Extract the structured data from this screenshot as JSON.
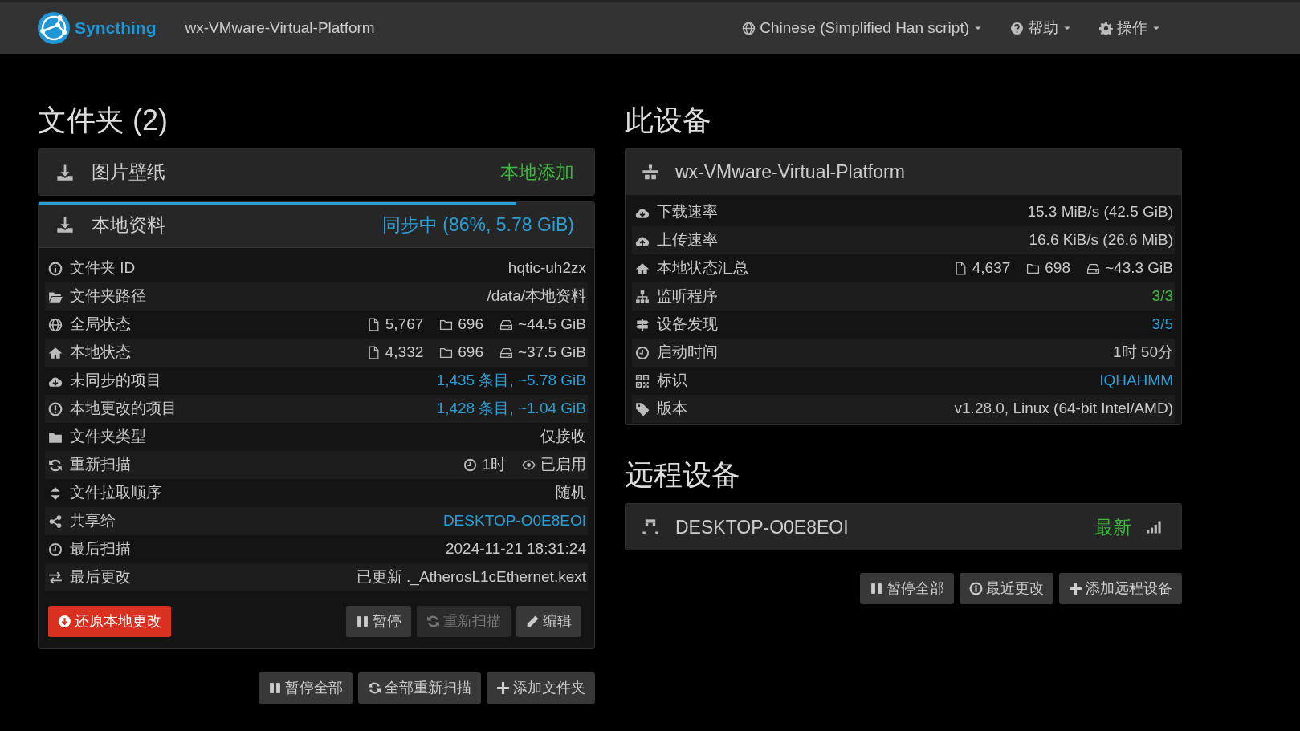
{
  "navbar": {
    "brand": "Syncthing",
    "device_name": "wx-VMware-Virtual-Platform",
    "menus": [
      "Chinese (Simplified Han script)",
      "帮助",
      "操作"
    ]
  },
  "folders": {
    "heading": "文件夹 (2)",
    "items": [
      {
        "name": "图片壁纸",
        "status": "本地添加",
        "color": "#3fb83f",
        "expanded": false
      },
      {
        "name": "本地资料",
        "status": "同步中 (86%, 5.78 GiB)",
        "color": "#2a9fd6",
        "level": 0.86,
        "expanded": true,
        "details": [
          {
            "kind": "text",
            "label": "文件夹 ID",
            "value": "hqtic-uh2zx"
          },
          {
            "kind": "text",
            "label": "文件夹路径",
            "value": "/data/本地资料"
          },
          {
            "kind": "stats",
            "label": "全局状态",
            "files": "5,767",
            "dirs": "696",
            "size": "~44.5 GiB"
          },
          {
            "kind": "stats",
            "label": "本地状态",
            "files": "4,332",
            "dirs": "696",
            "size": "~37.5 GiB"
          },
          {
            "kind": "text",
            "label": "未同步的项目",
            "value": "1,435 条目, ~5.78 GiB",
            "color": "#2a9fd6"
          },
          {
            "kind": "text",
            "label": "本地更改的项目",
            "value": "1,428 条目, ~1.04 GiB",
            "color": "#2a9fd6"
          },
          {
            "kind": "text",
            "label": "文件夹类型",
            "value": "仅接收"
          },
          {
            "kind": "rescan",
            "label": "重新扫描",
            "interval": "1时",
            "watch": "已启用"
          },
          {
            "kind": "text",
            "label": "文件拉取顺序",
            "value": "随机"
          },
          {
            "kind": "text",
            "label": "共享给",
            "value": "DESKTOP-O0E8EOI",
            "color": "#2a9fd6"
          },
          {
            "kind": "text",
            "label": "最后扫描",
            "value": "2024-11-21 18:31:24"
          },
          {
            "kind": "text",
            "label": "最后更改",
            "value": "已更新 ._AtherosL1cEthernet.kext"
          }
        ],
        "actions": [
          {
            "label": "还原本地更改",
            "kind": "danger",
            "disabled": false
          },
          {
            "label": "暂停",
            "kind": "default",
            "disabled": false
          },
          {
            "label": "重新扫描",
            "kind": "default",
            "disabled": true
          },
          {
            "label": "编辑",
            "kind": "default",
            "disabled": false
          }
        ]
      }
    ],
    "buttons": [
      "暂停全部",
      "全部重新扫描",
      "添加文件夹"
    ]
  },
  "this_device": {
    "heading": "此设备",
    "name": "wx-VMware-Virtual-Platform",
    "details": [
      {
        "kind": "text",
        "label": "下载速率",
        "value": "15.3 MiB/s (42.5 GiB)"
      },
      {
        "kind": "text",
        "label": "上传速率",
        "value": "16.6 KiB/s (26.6 MiB)"
      },
      {
        "kind": "stats",
        "label": "本地状态汇总",
        "files": "4,637",
        "dirs": "698",
        "size": "~43.3 GiB"
      },
      {
        "kind": "text",
        "label": "监听程序",
        "value": "3/3",
        "color": "#3fb83f"
      },
      {
        "kind": "text",
        "label": "设备发现",
        "value": "3/5",
        "color": "#2a9fd6"
      },
      {
        "kind": "text",
        "label": "启动时间",
        "value": "1时 50分"
      },
      {
        "kind": "text",
        "label": "标识",
        "value": "IQHAHMM",
        "color": "#2a9fd6"
      },
      {
        "kind": "text",
        "label": "版本",
        "value": "v1.28.0, Linux (64-bit Intel/AMD)"
      }
    ]
  },
  "remote_devices": {
    "heading": "远程设备",
    "devices": [
      {
        "name": "DESKTOP-O0E8EOI",
        "status": "最新",
        "color": "#3fb83f"
      }
    ],
    "buttons": [
      "暂停全部",
      "最近更改",
      "添加远程设备"
    ]
  }
}
